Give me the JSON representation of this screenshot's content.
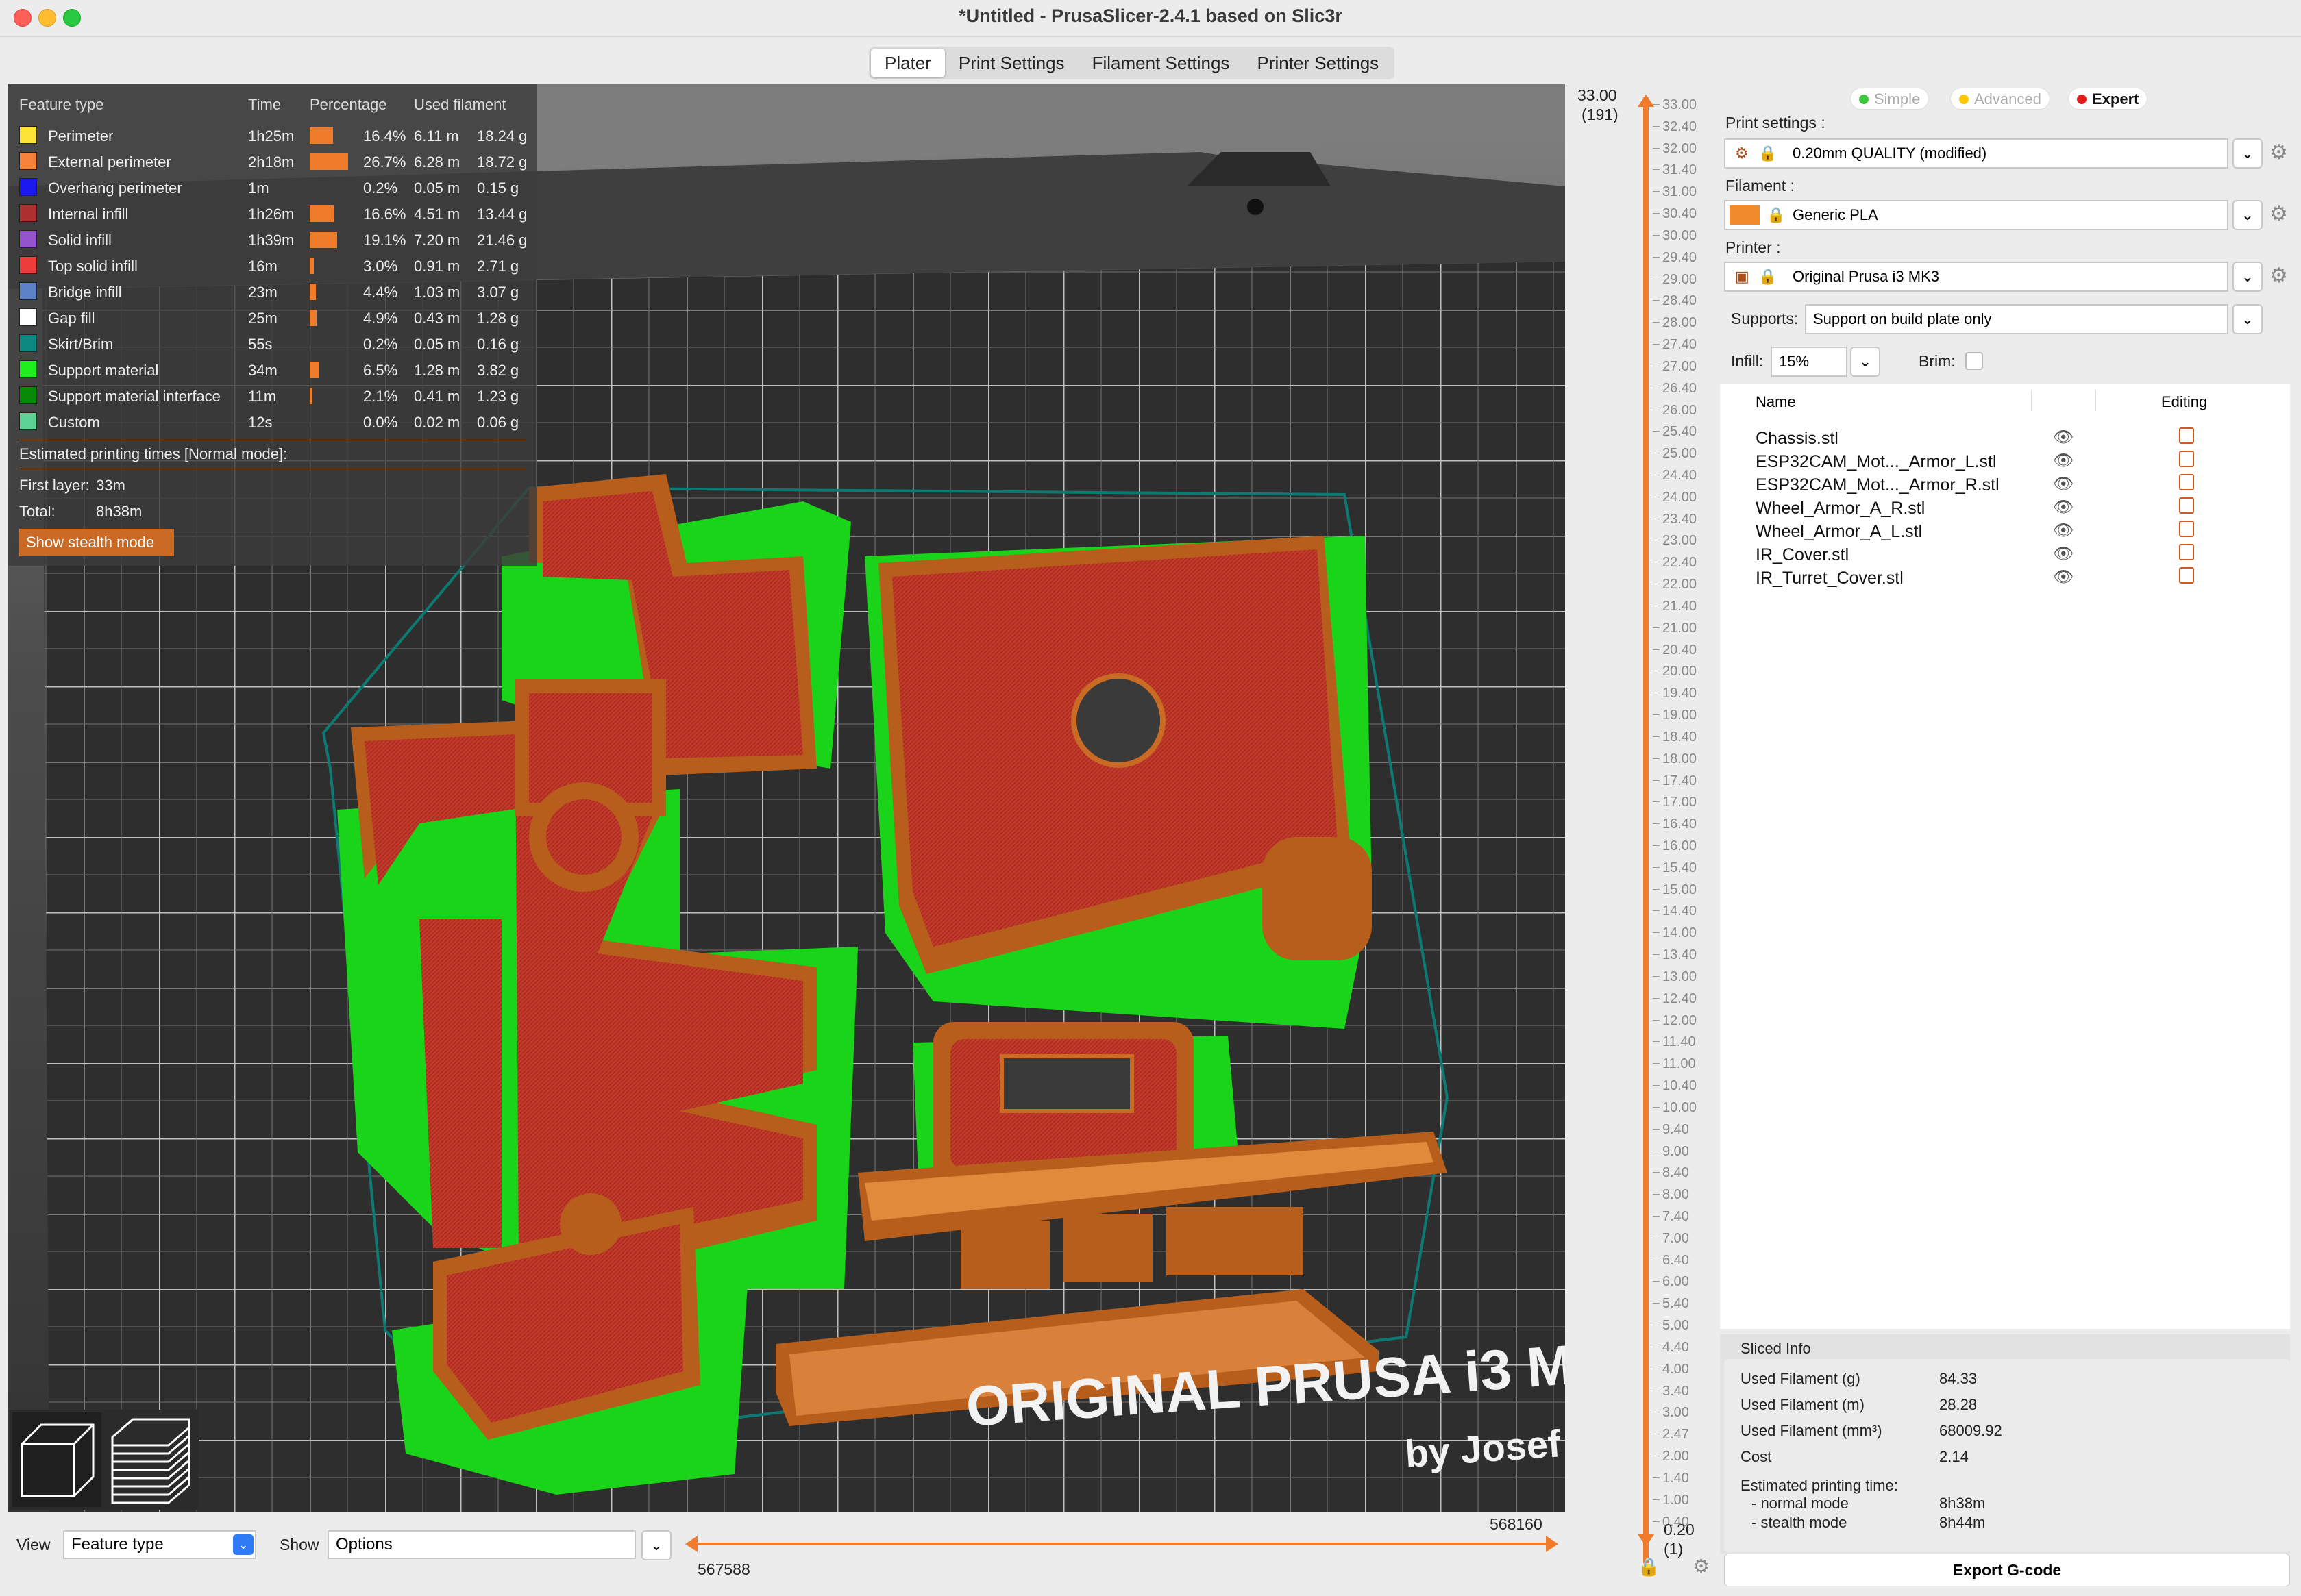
{
  "window": {
    "title": "*Untitled - PrusaSlicer-2.4.1 based on Slic3r"
  },
  "tabs": [
    {
      "label": "Plater",
      "active": true
    },
    {
      "label": "Print Settings",
      "active": false
    },
    {
      "label": "Filament Settings",
      "active": false
    },
    {
      "label": "Printer Settings",
      "active": false
    }
  ],
  "legend": {
    "headers": {
      "feature": "Feature type",
      "time": "Time",
      "percentage": "Percentage",
      "filament": "Used filament"
    },
    "rows": [
      {
        "name": "Perimeter",
        "color": "#fde338",
        "time": "1h25m",
        "pct": "16.4%",
        "pct_value": 16.4,
        "m": "6.11 m",
        "g": "18.24 g"
      },
      {
        "name": "External perimeter",
        "color": "#f7823a",
        "time": "2h18m",
        "pct": "26.7%",
        "pct_value": 26.7,
        "m": "6.28 m",
        "g": "18.72 g"
      },
      {
        "name": "Overhang perimeter",
        "color": "#1a1aef",
        "time": "1m",
        "pct": "0.2%",
        "pct_value": 0.2,
        "m": "0.05 m",
        "g": "0.15 g"
      },
      {
        "name": "Internal infill",
        "color": "#ad2f2f",
        "time": "1h26m",
        "pct": "16.6%",
        "pct_value": 16.6,
        "m": "4.51 m",
        "g": "13.44 g"
      },
      {
        "name": "Solid infill",
        "color": "#9455cc",
        "time": "1h39m",
        "pct": "19.1%",
        "pct_value": 19.1,
        "m": "7.20 m",
        "g": "21.46 g"
      },
      {
        "name": "Top solid infill",
        "color": "#ee3b3b",
        "time": "16m",
        "pct": "3.0%",
        "pct_value": 3.0,
        "m": "0.91 m",
        "g": "2.71 g"
      },
      {
        "name": "Bridge infill",
        "color": "#5a82c4",
        "time": "23m",
        "pct": "4.4%",
        "pct_value": 4.4,
        "m": "1.03 m",
        "g": "3.07 g"
      },
      {
        "name": "Gap fill",
        "color": "#ffffff",
        "time": "25m",
        "pct": "4.9%",
        "pct_value": 4.9,
        "m": "0.43 m",
        "g": "1.28 g"
      },
      {
        "name": "Skirt/Brim",
        "color": "#0c8a82",
        "time": "55s",
        "pct": "0.2%",
        "pct_value": 0.2,
        "m": "0.05 m",
        "g": "0.16 g"
      },
      {
        "name": "Support material",
        "color": "#1ef01e",
        "time": "34m",
        "pct": "6.5%",
        "pct_value": 6.5,
        "m": "1.28 m",
        "g": "3.82 g"
      },
      {
        "name": "Support material interface",
        "color": "#088a08",
        "time": "11m",
        "pct": "2.1%",
        "pct_value": 2.1,
        "m": "0.41 m",
        "g": "1.23 g"
      },
      {
        "name": "Custom",
        "color": "#5ed396",
        "time": "12s",
        "pct": "0.0%",
        "pct_value": 0.0,
        "m": "0.02 m",
        "g": "0.06 g"
      }
    ],
    "estimated_label": "Estimated printing times [Normal mode]:",
    "first_layer_label": "First layer:",
    "first_layer_value": "33m",
    "total_label": "Total:",
    "total_value": "8h38m",
    "stealth_button": "Show stealth mode"
  },
  "bed_text": {
    "line1": "ORIGINAL PRUSA i3 M",
    "line2": "by Josef"
  },
  "bottom": {
    "view_label": "View",
    "view_value": "Feature type",
    "show_label": "Show",
    "show_value": "Options",
    "h_min": "567588",
    "h_max": "568160"
  },
  "vslider": {
    "top_value": "33.00",
    "top_layer": "(191)",
    "bottom_value": "0.20",
    "bottom_layer": "(1)",
    "ticks": [
      "33.00",
      "32.40",
      "32.00",
      "31.40",
      "31.00",
      "30.40",
      "30.00",
      "29.40",
      "29.00",
      "28.40",
      "28.00",
      "27.40",
      "27.00",
      "26.40",
      "26.00",
      "25.40",
      "25.00",
      "24.40",
      "24.00",
      "23.40",
      "23.00",
      "22.40",
      "22.00",
      "21.40",
      "21.00",
      "20.40",
      "20.00",
      "19.40",
      "19.00",
      "18.40",
      "18.00",
      "17.40",
      "17.00",
      "16.40",
      "16.00",
      "15.40",
      "15.00",
      "14.40",
      "14.00",
      "13.40",
      "13.00",
      "12.40",
      "12.00",
      "11.40",
      "11.00",
      "10.40",
      "10.00",
      "9.40",
      "9.00",
      "8.40",
      "8.00",
      "7.40",
      "7.00",
      "6.40",
      "6.00",
      "5.40",
      "5.00",
      "4.40",
      "4.00",
      "3.40",
      "3.00",
      "2.47",
      "2.00",
      "1.40",
      "1.00",
      "0.40"
    ]
  },
  "right": {
    "modes": {
      "simple": "Simple",
      "advanced": "Advanced",
      "expert": "Expert"
    },
    "print_label": "Print settings :",
    "print_value": "0.20mm QUALITY (modified)",
    "filament_label": "Filament :",
    "filament_value": "Generic PLA",
    "filament_color": "#f08a2a",
    "printer_label": "Printer :",
    "printer_value": "Original Prusa i3 MK3",
    "supports_label": "Supports:",
    "supports_value": "Support on build plate only",
    "infill_label": "Infill:",
    "infill_value": "15%",
    "brim_label": "Brim:",
    "list_header_name": "Name",
    "list_header_editing": "Editing",
    "objects": [
      "Chassis.stl",
      "ESP32CAM_Mot..._Armor_L.stl",
      "ESP32CAM_Mot..._Armor_R.stl",
      "Wheel_Armor_A_R.stl",
      "Wheel_Armor_A_L.stl",
      "IR_Cover.stl",
      "IR_Turret_Cover.stl"
    ]
  },
  "sliced_info": {
    "title": "Sliced Info",
    "rows": [
      {
        "k": "Used Filament (g)",
        "v": "84.33"
      },
      {
        "k": "Used Filament (m)",
        "v": "28.28"
      },
      {
        "k": "Used Filament (mm³)",
        "v": "68009.92"
      },
      {
        "k": "Cost",
        "v": "2.14"
      }
    ],
    "est_label": "Estimated printing time:",
    "normal_label": "- normal mode",
    "normal_value": "8h38m",
    "stealth_label": "- stealth mode",
    "stealth_value": "8h44m"
  },
  "export_button": "Export G-code"
}
